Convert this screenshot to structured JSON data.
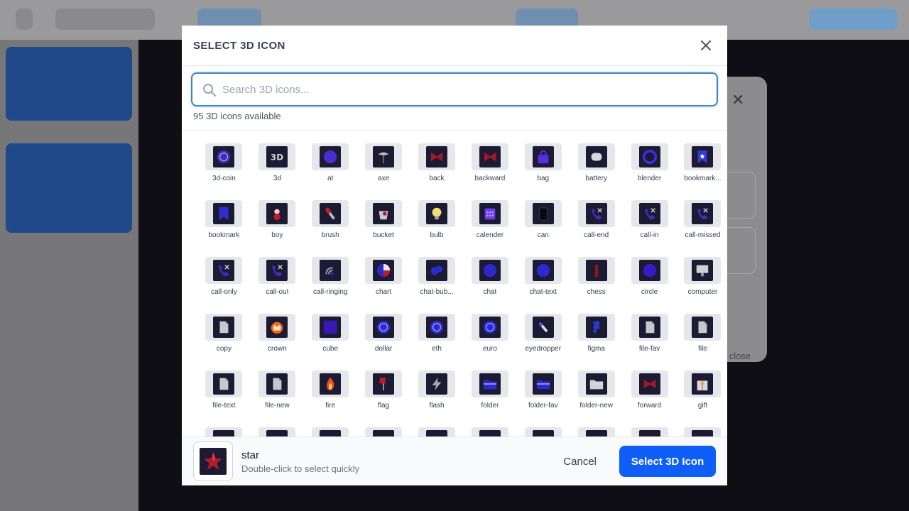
{
  "modal": {
    "title": "SELECT 3D ICON",
    "search_placeholder": "Search 3D icons...",
    "count_text": "95 3D icons available",
    "cancel_label": "Cancel",
    "select_label": "Select 3D Icon",
    "selected": {
      "name": "star",
      "hint": "Double-click to select quickly",
      "icon": "star-icon"
    }
  },
  "background": {
    "close_hint": "o close"
  },
  "icons": [
    {
      "label": "3d-coin",
      "shape": "coin",
      "color": "#3b2fb8"
    },
    {
      "label": "3d",
      "shape": "text3d",
      "color": "#d0d0d8"
    },
    {
      "label": "at",
      "shape": "circle",
      "color": "#4c2bd0"
    },
    {
      "label": "axe",
      "shape": "axe",
      "color": "#b9b9c4"
    },
    {
      "label": "back",
      "shape": "bow",
      "color": "#a01a24"
    },
    {
      "label": "backward",
      "shape": "bow",
      "color": "#a01a24"
    },
    {
      "label": "bag",
      "shape": "bag",
      "color": "#5a2ee0"
    },
    {
      "label": "battery",
      "shape": "battery",
      "color": "#d8d8dc"
    },
    {
      "label": "blender",
      "shape": "ring",
      "color": "#3b2fd8"
    },
    {
      "label": "bookmark...",
      "shape": "bookmarkstar",
      "color": "#2f3bd8"
    },
    {
      "label": "bookmark",
      "shape": "bookmark",
      "color": "#2f2fd0"
    },
    {
      "label": "boy",
      "shape": "boy",
      "color": "#c01a2a"
    },
    {
      "label": "brush",
      "shape": "brush",
      "color": "#c02030"
    },
    {
      "label": "bucket",
      "shape": "bucket",
      "color": "#c8c8cc"
    },
    {
      "label": "bulb",
      "shape": "bulb",
      "color": "#f0e070"
    },
    {
      "label": "calender",
      "shape": "calendar",
      "color": "#6a3ef0"
    },
    {
      "label": "can",
      "shape": "can",
      "color": "#0a0a12"
    },
    {
      "label": "call-end",
      "shape": "phone",
      "color": "#4a28c8"
    },
    {
      "label": "call-in",
      "shape": "phone",
      "color": "#4a28c8"
    },
    {
      "label": "call-missed",
      "shape": "phone",
      "color": "#4a28c8"
    },
    {
      "label": "call-only",
      "shape": "phone",
      "color": "#3a2ad8"
    },
    {
      "label": "call-out",
      "shape": "phone",
      "color": "#4a28c8"
    },
    {
      "label": "call-ringing",
      "shape": "waves",
      "color": "#8a8aa0"
    },
    {
      "label": "chart",
      "shape": "pie",
      "color": "#2a2ac8"
    },
    {
      "label": "chat-bub...",
      "shape": "bubbles",
      "color": "#2a2ad0"
    },
    {
      "label": "chat",
      "shape": "circle",
      "color": "#2a2ac8"
    },
    {
      "label": "chat-text",
      "shape": "circle",
      "color": "#2a2ad0"
    },
    {
      "label": "chess",
      "shape": "pawn",
      "color": "#8a1a1a"
    },
    {
      "label": "circle",
      "shape": "circle",
      "color": "#3a1ac8"
    },
    {
      "label": "computer",
      "shape": "monitor",
      "color": "#d0d0d4"
    },
    {
      "label": "copy",
      "shape": "paper",
      "color": "#c8c8cc"
    },
    {
      "label": "crown",
      "shape": "crown",
      "color": "#e86a1a"
    },
    {
      "label": "cube",
      "shape": "cube",
      "color": "#3a18b8"
    },
    {
      "label": "dollar",
      "shape": "coin",
      "color": "#2a2ad0"
    },
    {
      "label": "eth",
      "shape": "coin",
      "color": "#2a2ad0"
    },
    {
      "label": "euro",
      "shape": "coin",
      "color": "#2a2ad0"
    },
    {
      "label": "eyedropper",
      "shape": "dropper",
      "color": "#e0e0e8"
    },
    {
      "label": "figma",
      "shape": "figma",
      "color": "#2a3ad8"
    },
    {
      "label": "file-fav",
      "shape": "paper",
      "color": "#c8c8cc"
    },
    {
      "label": "file",
      "shape": "paper",
      "color": "#c8c8cc"
    },
    {
      "label": "file-text",
      "shape": "paper",
      "color": "#c8c8cc"
    },
    {
      "label": "file-new",
      "shape": "paper",
      "color": "#c8c8cc"
    },
    {
      "label": "fire",
      "shape": "flame",
      "color": "#e8501a"
    },
    {
      "label": "flag",
      "shape": "flag",
      "color": "#c01a2a"
    },
    {
      "label": "flash",
      "shape": "bolt",
      "color": "#a8a8b0"
    },
    {
      "label": "folder",
      "shape": "folder",
      "color": "#2a2ad0"
    },
    {
      "label": "folder-fav",
      "shape": "folder",
      "color": "#2a2ad0"
    },
    {
      "label": "folder-new",
      "shape": "folder",
      "color": "#d0d0d4"
    },
    {
      "label": "forward",
      "shape": "bow",
      "color": "#a01a24"
    },
    {
      "label": "gift",
      "shape": "gift",
      "color": "#d8d8dc"
    },
    {
      "label": "",
      "shape": "none",
      "color": "#2a2ad0"
    },
    {
      "label": "",
      "shape": "none",
      "color": "#2a2ad0"
    },
    {
      "label": "",
      "shape": "none",
      "color": "#2a2ad0"
    },
    {
      "label": "",
      "shape": "none",
      "color": "#2a2ad0"
    },
    {
      "label": "",
      "shape": "none",
      "color": "#c8c8cc"
    },
    {
      "label": "",
      "shape": "none",
      "color": "#2a2ad0"
    },
    {
      "label": "",
      "shape": "none",
      "color": "#5a2ee0"
    },
    {
      "label": "",
      "shape": "none",
      "color": "#c8c8cc"
    },
    {
      "label": "",
      "shape": "none",
      "color": "#c01a2a"
    },
    {
      "label": "",
      "shape": "none",
      "color": "#2a2ad0"
    }
  ]
}
